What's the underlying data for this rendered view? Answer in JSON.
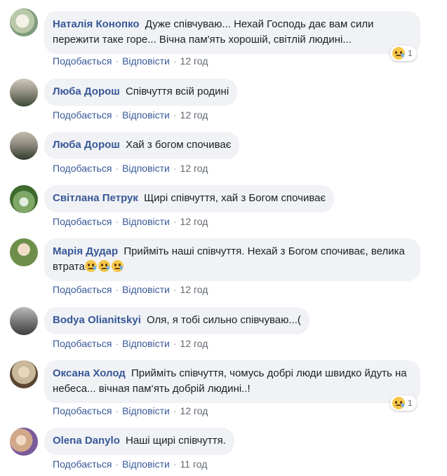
{
  "actions": {
    "like": "Подобається",
    "reply": "Відповісти",
    "separator": "·"
  },
  "comments": [
    {
      "author": "Наталія Конопко",
      "text": "Дуже співчуваю... Нехай Господь дає вам сили пережити таке горе... Вічна пам'ять хорошій, світлій людині...",
      "time": "12 год",
      "reaction_count": "1",
      "reaction": "sad",
      "avatar_colors": [
        "#d9d2b6",
        "#7e9b7c"
      ]
    },
    {
      "author": "Люба Дорош",
      "text": "Співчуття всій родині",
      "time": "12 год",
      "avatar_colors": [
        "#b8b0a4",
        "#3a4a35"
      ]
    },
    {
      "author": "Люба Дорош",
      "text": "Хай з богом спочиває",
      "time": "12 год",
      "avatar_colors": [
        "#a9a39a",
        "#2f3b2c"
      ]
    },
    {
      "author": "Світлана Петрук",
      "text": "Щирі співчуття, хай з Богом спочиває",
      "time": "12 год",
      "avatar_colors": [
        "#4f7c3a",
        "#cfe2c4"
      ]
    },
    {
      "author": "Марія Дудар",
      "text": "Прийміть наші співчуття. Нехай з Богом спочиває, велика втрата",
      "time": "12 год",
      "inline_emoji_count": 3,
      "avatar_colors": [
        "#6e8f4a",
        "#e7d9c8"
      ]
    },
    {
      "author": "Bodya Olianitskyi",
      "text": "Оля, я тобі сильно співчуваю...(",
      "time": "12 год",
      "avatar_colors": [
        "#8c8c8c",
        "#3c3c3c"
      ]
    },
    {
      "author": "Оксана Холод",
      "text": "Прийміть співчуття, чомусь добрі люди швидко йдуть на небеса... вічная пам‘ять добрій людині..!",
      "time": "12 год",
      "reaction_count": "1",
      "reaction": "sad",
      "avatar_colors": [
        "#c9b89a",
        "#5a4632"
      ]
    },
    {
      "author": "Olena Danylo",
      "text": "Наші щирі співчуття.",
      "time": "11 год",
      "avatar_colors": [
        "#d1a88a",
        "#7a5a9a"
      ]
    }
  ],
  "colors": {
    "author": "#385898",
    "bubble": "#f0f2f5",
    "meta_time": "#616770"
  }
}
